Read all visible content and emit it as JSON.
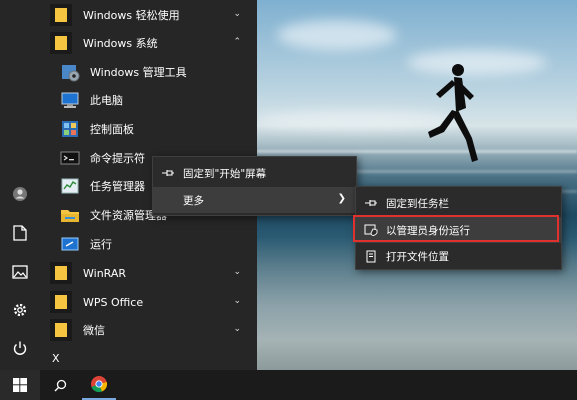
{
  "start_menu": {
    "apps": [
      {
        "label": "Windows 轻松使用",
        "icon": "folder-icon",
        "expanded": false
      },
      {
        "label": "Windows 系统",
        "icon": "folder-icon",
        "expanded": true
      },
      {
        "label": "Windows 管理工具",
        "icon": "admin-tools-icon"
      },
      {
        "label": "此电脑",
        "icon": "this-pc-icon"
      },
      {
        "label": "控制面板",
        "icon": "control-panel-icon"
      },
      {
        "label": "命令提示符",
        "icon": "command-prompt-icon"
      },
      {
        "label": "任务管理器",
        "icon": "task-manager-icon"
      },
      {
        "label": "文件资源管理器",
        "icon": "file-explorer-icon"
      },
      {
        "label": "运行",
        "icon": "run-icon"
      },
      {
        "label": "WinRAR",
        "icon": "folder-icon",
        "expanded": false
      },
      {
        "label": "WPS Office",
        "icon": "folder-icon",
        "expanded": false
      },
      {
        "label": "微信",
        "icon": "folder-icon",
        "expanded": false
      }
    ],
    "section_letter": "X",
    "rail": [
      "user-icon",
      "documents-icon",
      "pictures-icon",
      "settings-icon",
      "power-icon"
    ]
  },
  "context_menu": {
    "pin_start": "固定到\"开始\"屏幕",
    "more": "更多"
  },
  "submenu": {
    "pin_taskbar": "固定到任务栏",
    "run_as_admin": "以管理员身份运行",
    "open_location": "打开文件位置"
  },
  "colors": {
    "start_bg": "#262626",
    "folder": "#f5c542",
    "highlight_border": "#e0312e",
    "tile_blue": "#1e73d0"
  }
}
